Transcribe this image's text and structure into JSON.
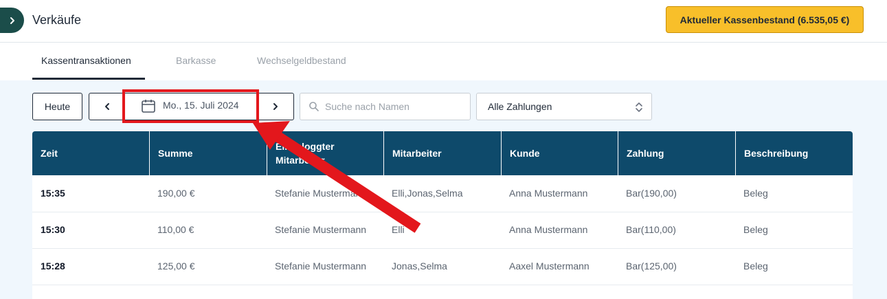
{
  "header": {
    "title": "Verkäufe",
    "cash_button_label": "Aktueller Kassenbestand (6.535,05 €)"
  },
  "tabs": [
    {
      "label": "Kassentransaktionen",
      "active": true
    },
    {
      "label": "Barkasse",
      "active": false
    },
    {
      "label": "Wechselgeldbestand",
      "active": false
    }
  ],
  "filters": {
    "today_label": "Heute",
    "date_label": "Mo., 15. Juli 2024",
    "search_placeholder": "Suche nach Namen",
    "payment_select": "Alle Zahlungen"
  },
  "table": {
    "columns": [
      "Zeit",
      "Summe",
      "Eingeloggter\nMitarbeiter",
      "Mitarbeiter",
      "Kunde",
      "Zahlung",
      "Beschreibung"
    ],
    "rows": [
      [
        "15:35",
        "190,00 €",
        "Stefanie Mustermann",
        "Elli,Jonas,Selma",
        "Anna Mustermann",
        "Bar(190,00)",
        "Beleg"
      ],
      [
        "15:30",
        "110,00 €",
        "Stefanie Mustermann",
        "Elli",
        "Anna Mustermann",
        "Bar(110,00)",
        "Beleg"
      ],
      [
        "15:28",
        "125,00 €",
        "Stefanie Mustermann",
        "Jonas,Selma",
        "Aaxel Mustermann",
        "Bar(125,00)",
        "Beleg"
      ]
    ]
  },
  "colors": {
    "accent": "#f8bf2a",
    "table_header": "#0e4a6b",
    "sidebar_toggle": "#1b4d4a",
    "annotation": "#e3171c",
    "content_bg": "#f0f7fd"
  },
  "icons": {
    "sidebar_toggle": "chevron-right-icon",
    "prev": "chevron-left-icon",
    "next": "chevron-right-icon",
    "date": "calendar-icon",
    "search": "search-icon",
    "select": "chevron-up-down-icon"
  }
}
